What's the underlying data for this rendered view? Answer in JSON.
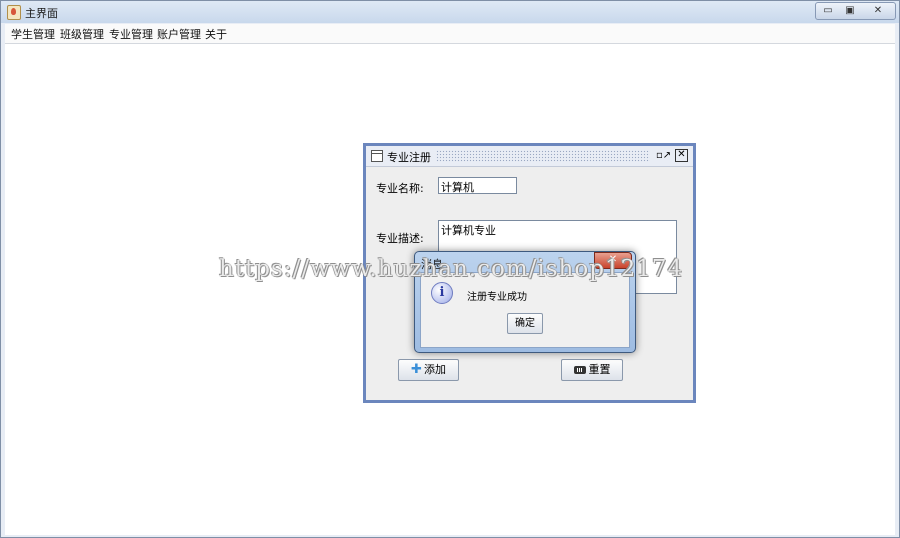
{
  "window": {
    "title": "主界面",
    "icon": "java-cup-icon",
    "controls": {
      "minimize": "▭",
      "maximize": "▣",
      "close": "✕"
    }
  },
  "menu": [
    {
      "label": "学生管理"
    },
    {
      "label": "班级管理"
    },
    {
      "label": "专业管理"
    },
    {
      "label": "账户管理"
    },
    {
      "label": "关于"
    }
  ],
  "internal_frame": {
    "title": "专业注册",
    "restore_glyph": "▫↗",
    "close_glyph": "✕",
    "name_label": "专业名称:",
    "name_value": "计算机",
    "desc_label": "专业描述:",
    "desc_value": "计算机专业",
    "add_label": "添加",
    "reset_label": "重置"
  },
  "dialog": {
    "title": "消息",
    "close_glyph": "✕",
    "icon": "info-icon",
    "icon_glyph": "i",
    "message": "注册专业成功",
    "ok_label": "确定"
  },
  "watermark": "https://www.huzhan.com/ishop12174"
}
